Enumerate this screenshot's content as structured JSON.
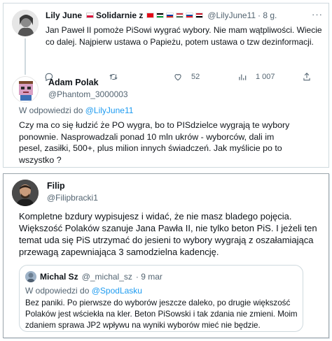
{
  "tweet1": {
    "name": "Lily June",
    "name_suffix": "Solidarnie z",
    "handle": "@LilyJune11",
    "time": "· 8 g.",
    "text_line1": "Jan Paweł II pomoże PiSowi wygrać wybory. Nie mam wątpliwości. Wiecie",
    "text_line2": "co dalej. Najpierw ustawa o Papieżu, potem ustawa o tzw dezinformacji.",
    "replies": "",
    "retweets": "",
    "likes": "52",
    "views": "1 007",
    "flags": [
      "poland",
      "turkey",
      "palestine",
      "russia",
      "hungary",
      "slovakia",
      "egypt"
    ]
  },
  "tweet2": {
    "name": "Adam Polak",
    "handle": "@Phantom_3000003",
    "reply_prefix": "W odpowiedzi do",
    "reply_to": "@LilyJune11",
    "text_line1": "Czy ma co się łudzić że PO wygra, bo to PISdzielce wygrają te wybory",
    "text_line2": "ponownie. Nasprowadzali ponad 10 mln ukrów - wyborców, dali im",
    "text_line3": "pesel, zasiłki, 500+, plus milion innych świadczeń. Jak myślicie po to",
    "text_line4": "wszystko ?"
  },
  "tweet3": {
    "name": "Filip",
    "handle": "@Filipbracki1",
    "text_line1": "Kompletne bzdury wypisujesz i widać, że nie masz bladego pojęcia.",
    "text_line2": "Większość Polaków szanuje Jana Pawła II, nie tylko beton PiS. I jeżeli ten",
    "text_line3": "temat uda się PiS utrzymać do jesieni to wybory wygrają z oszałamiająca",
    "text_line4": "przewagą zapewniająca 3 samodzielna kadencję."
  },
  "quote": {
    "name": "Michal Sz",
    "handle": "@_michal_sz",
    "time": "· 9 mar",
    "reply_prefix": "W odpowiedzi do",
    "reply_to": "@SpodLasku",
    "text_line1": "Bez paniki. Po pierwsze do wyborów jeszcze daleko, po drugie większość",
    "text_line2": "Polaków jest wściekła na kler. Beton PiSowski i tak zdania nie zmieni. Moim",
    "text_line3": "zdaniem sprawa JP2 wpływu na wyniki wyborów mieć nie będzie."
  },
  "colors": {
    "link": "#1d9bf0",
    "muted": "#536471",
    "text": "#0f1419",
    "border": "#cfd9de"
  },
  "icons": [
    "reply-icon",
    "retweet-icon",
    "like-icon",
    "views-icon"
  ]
}
